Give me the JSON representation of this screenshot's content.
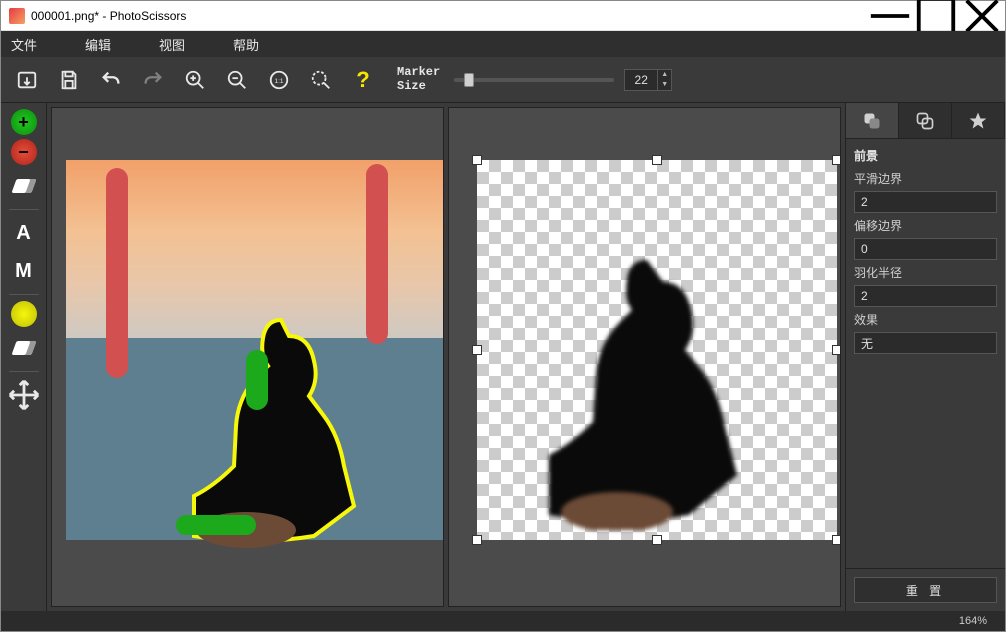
{
  "window": {
    "title": "000001.png* - PhotoScissors"
  },
  "menu": {
    "file": "文件",
    "edit": "编辑",
    "view": "视图",
    "help": "帮助"
  },
  "toolbar": {
    "marker_label_line1": "Marker",
    "marker_label_line2": "Size",
    "marker_value": "22"
  },
  "panel": {
    "heading": "前景",
    "smooth_label": "平滑边界",
    "smooth_value": "2",
    "offset_label": "偏移边界",
    "offset_value": "0",
    "feather_label": "羽化半径",
    "feather_value": "2",
    "effect_label": "效果",
    "effect_value": "无",
    "reset": "重 置"
  },
  "status": {
    "zoom": "164%"
  }
}
